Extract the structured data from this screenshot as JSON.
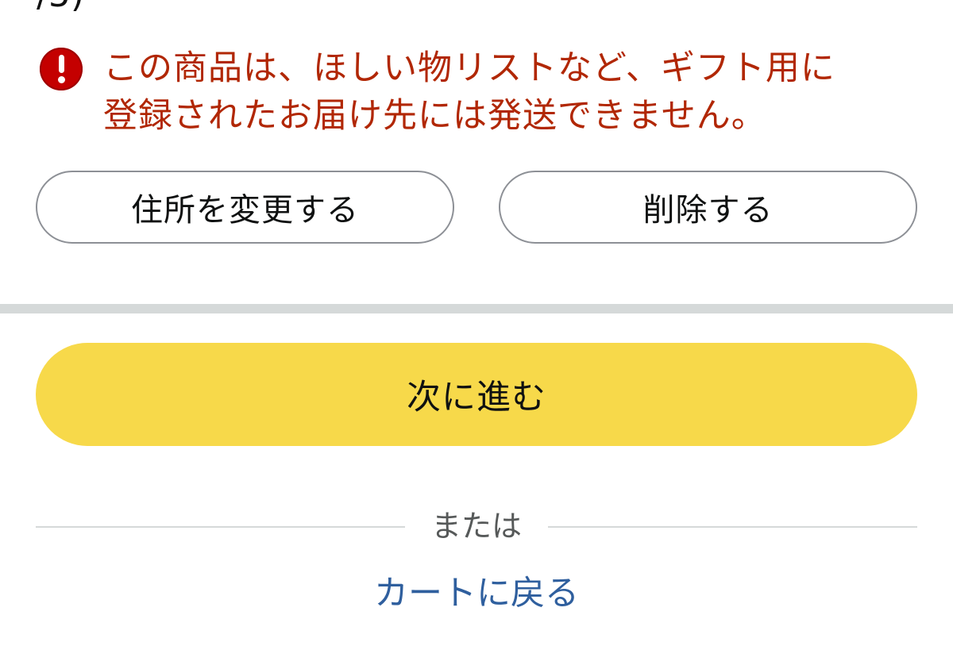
{
  "header": {
    "cutoff_text": "/5)"
  },
  "alert": {
    "icon": "exclamation-circle-icon",
    "message_line1": "この商品は、ほしい物リストなど、ギフト用に",
    "message_line2": "登録されたお届け先には発送できません。",
    "color": "#b12704"
  },
  "actions": {
    "change_address_label": "住所を変更する",
    "delete_label": "削除する"
  },
  "primary": {
    "continue_label": "次に進む",
    "color": "#f7d94a"
  },
  "separator": {
    "or_label": "または"
  },
  "links": {
    "back_to_cart_label": "カートに戻る",
    "color": "#2f5f9e"
  }
}
